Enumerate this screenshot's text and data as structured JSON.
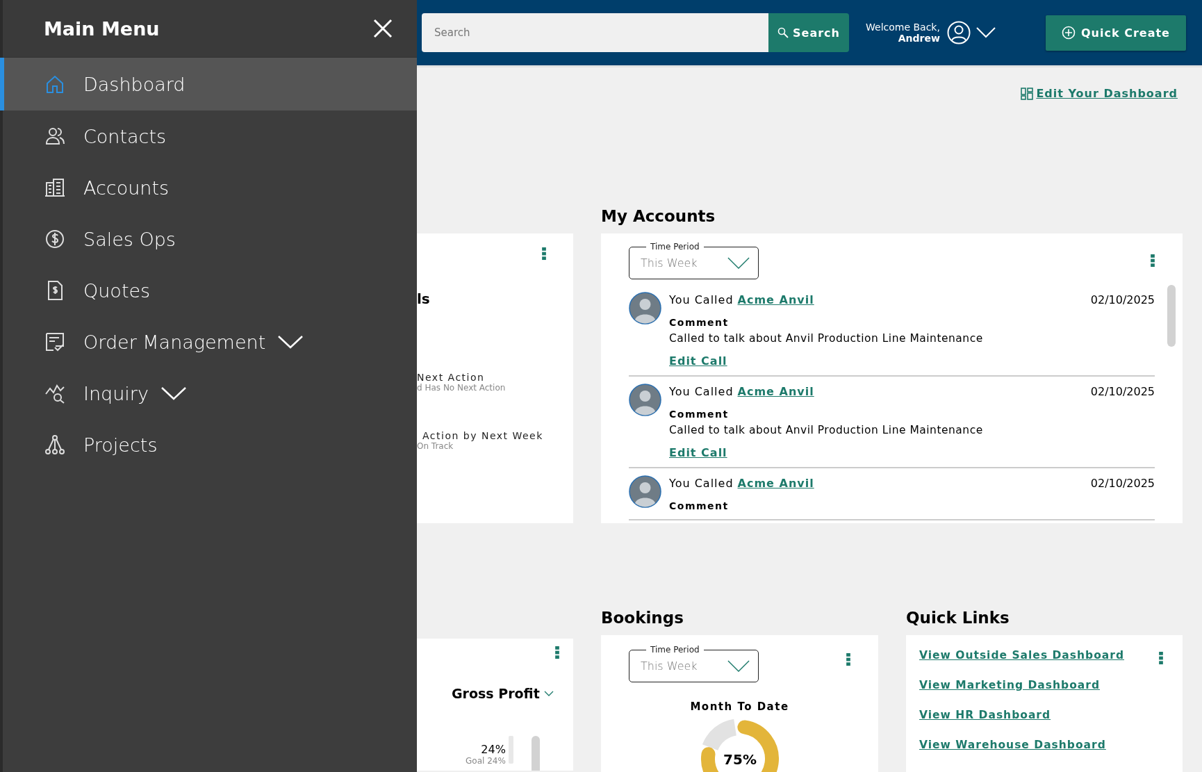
{
  "sidebar": {
    "title": "Main Menu",
    "items": [
      {
        "label": "Dashboard",
        "selected": true,
        "has_submenu": false
      },
      {
        "label": "Contacts",
        "selected": false,
        "has_submenu": false
      },
      {
        "label": "Accounts",
        "selected": false,
        "has_submenu": false
      },
      {
        "label": "Sales Ops",
        "selected": false,
        "has_submenu": false
      },
      {
        "label": "Quotes",
        "selected": false,
        "has_submenu": false
      },
      {
        "label": "Order Management",
        "selected": false,
        "has_submenu": true
      },
      {
        "label": "Inquiry",
        "selected": false,
        "has_submenu": true
      },
      {
        "label": "Projects",
        "selected": false,
        "has_submenu": false
      }
    ]
  },
  "header": {
    "search": {
      "placeholder": "Search"
    },
    "search_button": "Search",
    "welcome": "Welcome Back,",
    "user": "Andrew",
    "quick_create": "Quick Create"
  },
  "edit_dashboard_link": "Edit Your Dashboard",
  "next_actions_card": {
    "title": "ls",
    "items": [
      {
        "label": "Next Action",
        "detail": "d Has No Next Action"
      },
      {
        "label": "Action by Next Week",
        "detail": "On Track"
      }
    ]
  },
  "my_accounts": {
    "title": "My Accounts",
    "time_period": {
      "label": "Time Period",
      "value": "This Week"
    },
    "activities": [
      {
        "prefix": "You Called",
        "account": "Acme Anvil",
        "date": "02/10/2025",
        "comment_label": "Comment",
        "comment": "Called to talk about Anvil Production Line Maintenance",
        "action": "Edit Call"
      },
      {
        "prefix": "You Called",
        "account": "Acme Anvil",
        "date": "02/10/2025",
        "comment_label": "Comment",
        "comment": "Called to talk about Anvil Production Line Maintenance",
        "action": "Edit Call"
      },
      {
        "prefix": "You Called",
        "account": "Acme Anvil",
        "date": "02/10/2025",
        "comment_label": "Comment"
      }
    ]
  },
  "gross_profit_card": {
    "metric": "Gross Profit",
    "value": "24%",
    "goal": "Goal 24%"
  },
  "bookings": {
    "title": "Bookings",
    "time_period": {
      "label": "Time Period",
      "value": "This Week"
    },
    "gauge": {
      "title": "Month To Date",
      "level": 0.75,
      "reading": "75%"
    }
  },
  "quick_links": {
    "title": "Quick Links",
    "links": [
      "View Outside Sales Dashboard",
      "View Marketing Dashboard",
      "View HR Dashboard",
      "View Warehouse Dashboard"
    ]
  }
}
